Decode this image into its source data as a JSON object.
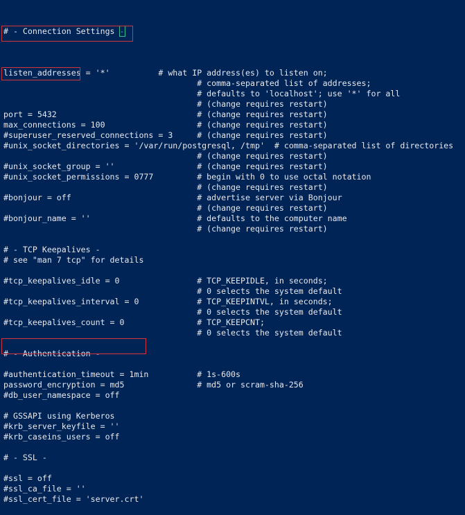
{
  "terminal": {
    "background": "#012456",
    "foreground": "#e8e8ec",
    "highlight_color": "#d0353a",
    "cursor_color": "#2fbf8f",
    "header": "# - Connection Settings ",
    "cursor_char": "-",
    "lines": [
      "",
      "listen_addresses = '*'          # what IP address(es) to listen on;",
      "                                        # comma-separated list of addresses;",
      "                                        # defaults to 'localhost'; use '*' for all",
      "                                        # (change requires restart)",
      "port = 5432                             # (change requires restart)",
      "max_connections = 100                   # (change requires restart)",
      "#superuser_reserved_connections = 3     # (change requires restart)",
      "#unix_socket_directories = '/var/run/postgresql, /tmp'  # comma-separated list of directories",
      "                                        # (change requires restart)",
      "#unix_socket_group = ''                 # (change requires restart)",
      "#unix_socket_permissions = 0777         # begin with 0 to use octal notation",
      "                                        # (change requires restart)",
      "#bonjour = off                          # advertise server via Bonjour",
      "                                        # (change requires restart)",
      "#bonjour_name = ''                      # defaults to the computer name",
      "                                        # (change requires restart)",
      "",
      "# - TCP Keepalives -",
      "# see \"man 7 tcp\" for details",
      "",
      "#tcp_keepalives_idle = 0                # TCP_KEEPIDLE, in seconds;",
      "                                        # 0 selects the system default",
      "#tcp_keepalives_interval = 0            # TCP_KEEPINTVL, in seconds;",
      "                                        # 0 selects the system default",
      "#tcp_keepalives_count = 0               # TCP_KEEPCNT;",
      "                                        # 0 selects the system default",
      "",
      "# - Authentication -",
      "",
      "#authentication_timeout = 1min          # 1s-600s",
      "password_encryption = md5               # md5 or scram-sha-256",
      "#db_user_namespace = off",
      "",
      "# GSSAPI using Kerberos",
      "#krb_server_keyfile = ''",
      "#krb_caseins_users = off",
      "",
      "# - SSL -",
      "",
      "#ssl = off",
      "#ssl_ca_file = ''",
      "#ssl_cert_file = 'server.crt'"
    ]
  }
}
